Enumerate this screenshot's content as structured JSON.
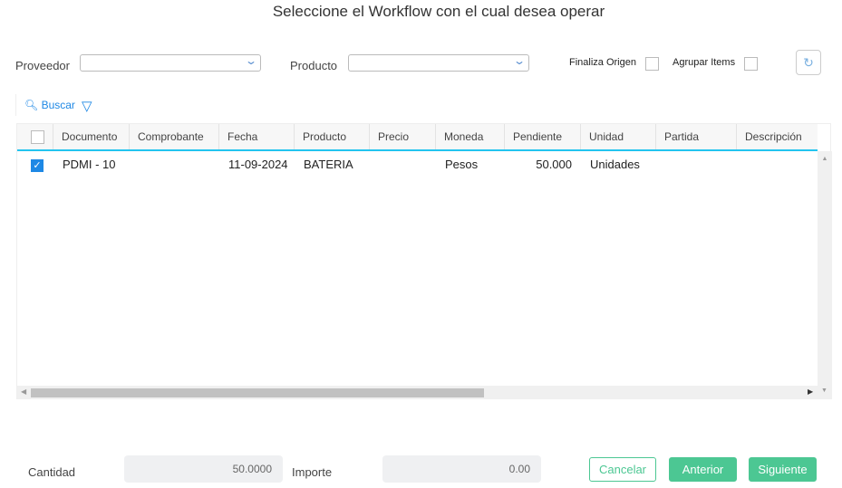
{
  "title": "Seleccione el Workflow con el cual desea operar",
  "filters": {
    "proveedor_label": "Proveedor",
    "proveedor_value": "",
    "producto_label": "Producto",
    "producto_value": "",
    "finaliza_label": "Finaliza Origen",
    "agrupar_label": "Agrupar Items"
  },
  "toolbar": {
    "buscar_label": "Buscar"
  },
  "grid": {
    "columns": [
      "Documento",
      "Comprobante",
      "Fecha",
      "Producto",
      "Precio",
      "Moneda",
      "Pendiente",
      "Unidad",
      "Partida",
      "Descripción"
    ],
    "rows": [
      {
        "checked": true,
        "documento": "PDMI - 10",
        "comprobante": "",
        "fecha": "11-09-2024",
        "producto": "BATERIA",
        "precio": "",
        "moneda": "Pesos",
        "pendiente": "50.000",
        "unidad": "Unidades",
        "partida": "",
        "descripcion": ""
      }
    ]
  },
  "footer": {
    "cantidad_label": "Cantidad",
    "cantidad_value": "50.0000",
    "importe_label": "Importe",
    "importe_value": "0.00",
    "cancelar": "Cancelar",
    "anterior": "Anterior",
    "siguiente": "Siguiente"
  }
}
